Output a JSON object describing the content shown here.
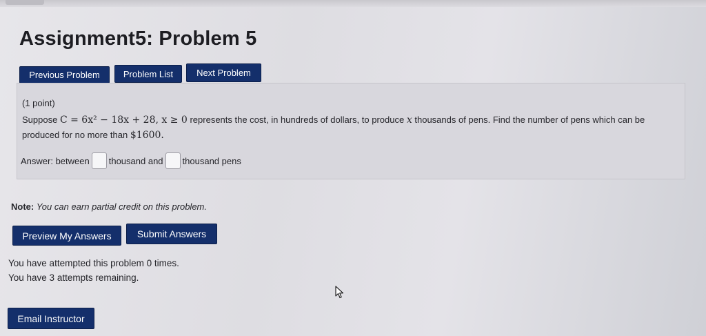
{
  "header": {
    "title": "Assignment5: Problem 5"
  },
  "nav": {
    "previous": "Previous Problem",
    "list": "Problem List",
    "next": "Next Problem"
  },
  "problem": {
    "points": "(1 point)",
    "statement_prefix": "Suppose",
    "formula": "C = 6x² − 18x + 28, x ≥ 0",
    "statement_middle": "represents the cost, in hundreds of dollars, to produce",
    "var_x": "x",
    "statement_end": "thousands of pens. Find the number of pens which can be produced for no more than",
    "amount": "$1600.",
    "answer_prefix": "Answer: between",
    "answer_middle": "thousand and",
    "answer_suffix": "thousand pens",
    "answer1_value": "",
    "answer2_value": ""
  },
  "note": {
    "label": "Note:",
    "text": "You can earn partial credit on this problem."
  },
  "actions": {
    "preview": "Preview My Answers",
    "submit": "Submit Answers"
  },
  "status": {
    "attempted": "You have attempted this problem 0 times.",
    "remaining": "You have 3 attempts remaining."
  },
  "footer": {
    "email": "Email Instructor"
  },
  "colors": {
    "button_bg": "#142f6b",
    "button_text": "#ffffff",
    "problem_box_bg": "#d8d7dd"
  }
}
